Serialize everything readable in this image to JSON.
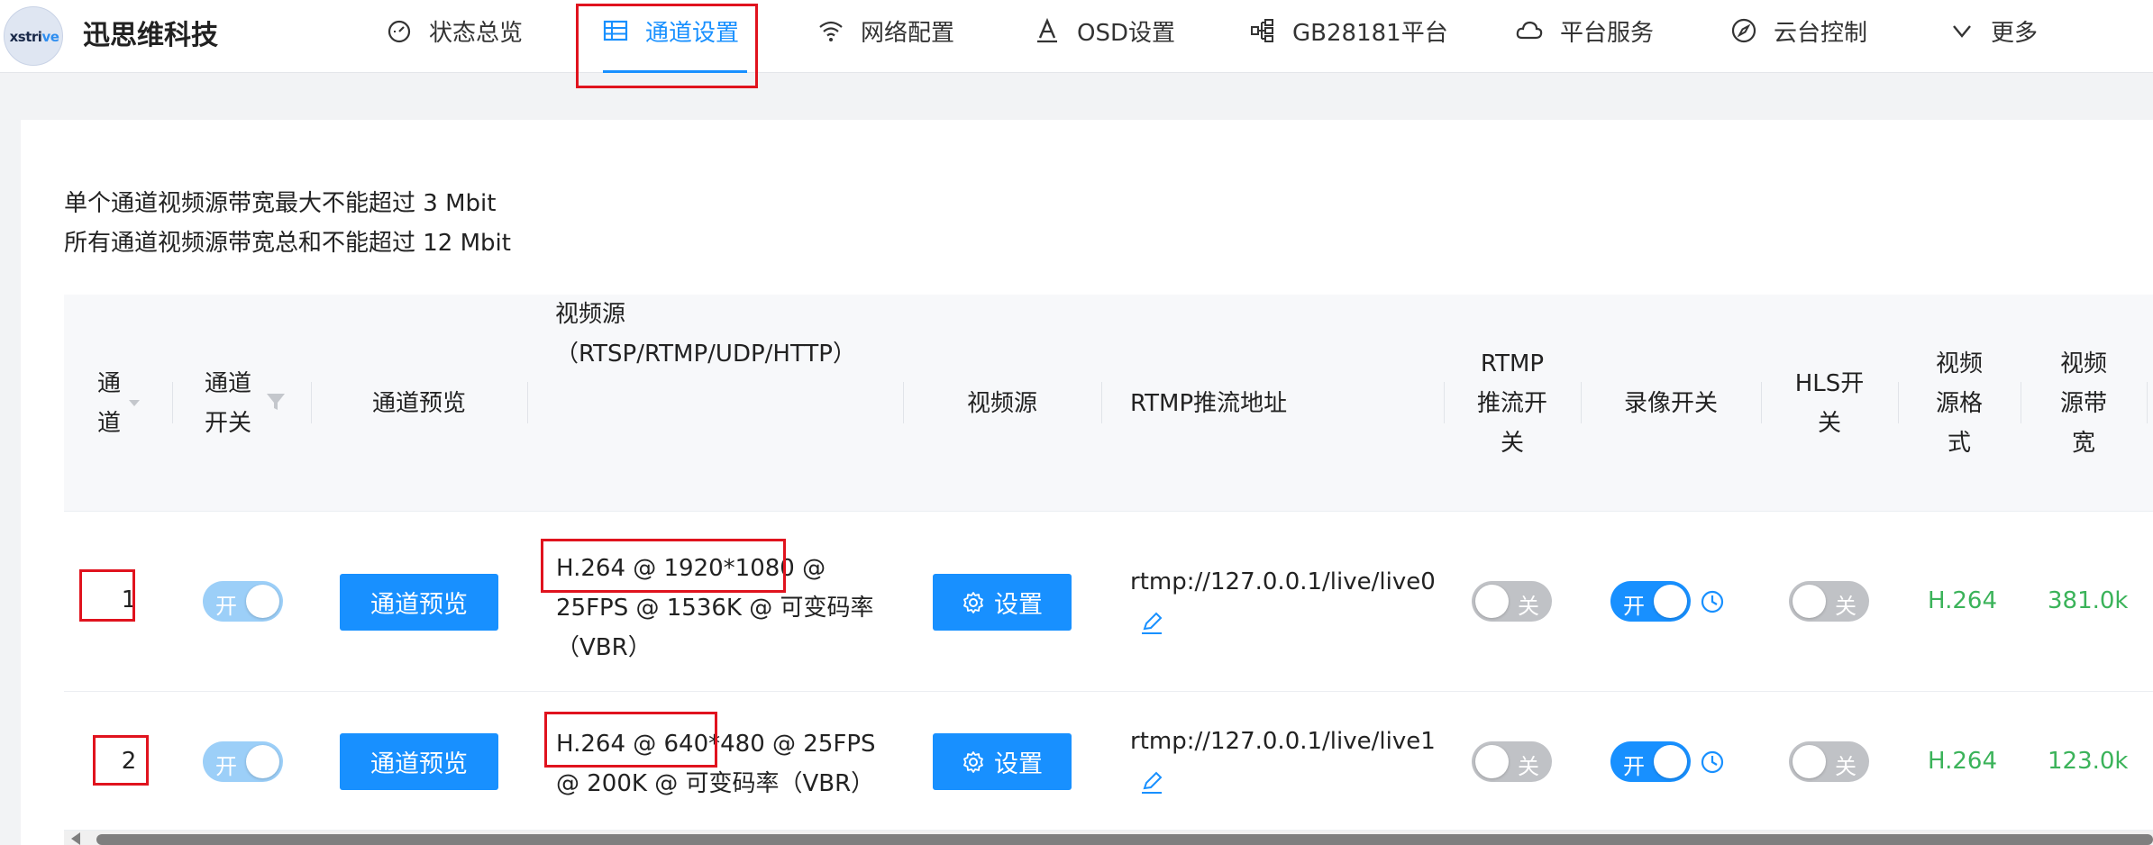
{
  "app": {
    "logo_text_a": "xstri",
    "logo_text_b": "ve",
    "brand": "迅思维科技"
  },
  "nav": {
    "items": [
      {
        "label": "状态总览",
        "icon": "dashboard-icon"
      },
      {
        "label": "通道设置",
        "icon": "table-icon",
        "active": true
      },
      {
        "label": "网络配置",
        "icon": "wifi-icon"
      },
      {
        "label": "OSD设置",
        "icon": "font-icon"
      },
      {
        "label": "GB28181平台",
        "icon": "cluster-icon"
      },
      {
        "label": "平台服务",
        "icon": "cloud-icon"
      },
      {
        "label": "云台控制",
        "icon": "compass-icon"
      },
      {
        "label": "更多",
        "icon": "chevron-down-icon"
      }
    ]
  },
  "notes": {
    "line1": "单个通道视频源带宽最大不能超过 3 Mbit",
    "line2": "所有通道视频源带宽总和不能超过 12 Mbit"
  },
  "table": {
    "headers": {
      "channel": [
        "通",
        "道"
      ],
      "channel_switch": [
        "通道",
        "开关"
      ],
      "preview": "通道预览",
      "source": [
        "视频源",
        "（RTSP/RTMP/UDP/HTTP）"
      ],
      "source_settings": "视频源",
      "rtmp_addr": "RTMP推流地址",
      "rtmp_switch": [
        "RTMP",
        "推流开",
        "关"
      ],
      "record_switch": "录像开关",
      "hls_switch": [
        "HLS开",
        "关"
      ],
      "src_format": [
        "视频",
        "源格",
        "式"
      ],
      "src_bw": [
        "视频",
        "源带",
        "宽"
      ]
    },
    "rows": [
      {
        "channel": "1",
        "switch_label": "开",
        "preview_btn": "通道预览",
        "source_codec": "H.264 @ 1920*1080",
        "source_rest_1": " @",
        "source_rest_2": "25FPS @ 1536K @ 可变码率",
        "source_rest_3": "（VBR）",
        "settings_btn": "设置",
        "rtmp_url": "rtmp://127.0.0.1/live/live0",
        "rtmp_switch_label": "关",
        "record_switch_label": "开",
        "hls_switch_label": "关",
        "format": "H.264",
        "bandwidth": "381.0k"
      },
      {
        "channel": "2",
        "switch_label": "开",
        "preview_btn": "通道预览",
        "source_codec": "H.264 @ 640*480",
        "source_rest_1": " @ 25FPS",
        "source_rest_2": "@ 200K @ 可变码率（VBR）",
        "source_rest_3": "",
        "settings_btn": "设置",
        "rtmp_url": "rtmp://127.0.0.1/live/live1",
        "rtmp_switch_label": "关",
        "record_switch_label": "开",
        "hls_switch_label": "关",
        "format": "H.264",
        "bandwidth": "123.0k"
      }
    ]
  },
  "colors": {
    "accent": "#1890ff",
    "highlight": "#e0131e",
    "success": "#3bb35a"
  }
}
